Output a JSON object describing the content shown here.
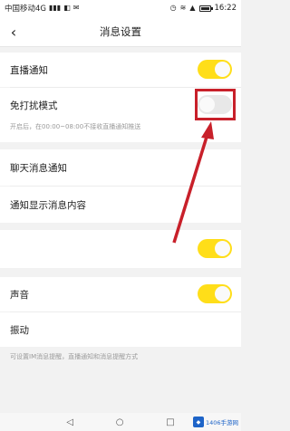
{
  "status_bar": {
    "carrier": "中国移动4G",
    "time": "16:22",
    "battery_level": 0.9
  },
  "header": {
    "title": "消息设置",
    "back_icon": "chevron-left-icon"
  },
  "settings": {
    "live_notify": {
      "label": "直播通知",
      "on": true
    },
    "dnd": {
      "label": "免打扰模式",
      "on": false,
      "hint": "开启后，在00:00~08:00不接收直播通知推送"
    },
    "chat_notify": {
      "label": "聊天消息通知"
    },
    "show_content": {
      "label": "通知显示消息内容"
    },
    "unlabeled_toggle": {
      "label": "",
      "on": true
    },
    "sound": {
      "label": "声音",
      "on": true
    },
    "vibrate": {
      "label": "振动"
    },
    "footnote": "可设置IM消息提醒，直播通知和消息提醒方式"
  },
  "annotation": {
    "highlight_color": "#c8202a"
  },
  "system_nav": {
    "back_icon": "triangle-back-icon",
    "home_icon": "circle-home-icon",
    "recents_icon": "square-recents-icon"
  },
  "watermark": {
    "text": "1406手游网"
  },
  "colors": {
    "toggle_on": "#ffde19",
    "toggle_off": "#e8e8e8",
    "background": "#f2f2f2"
  }
}
